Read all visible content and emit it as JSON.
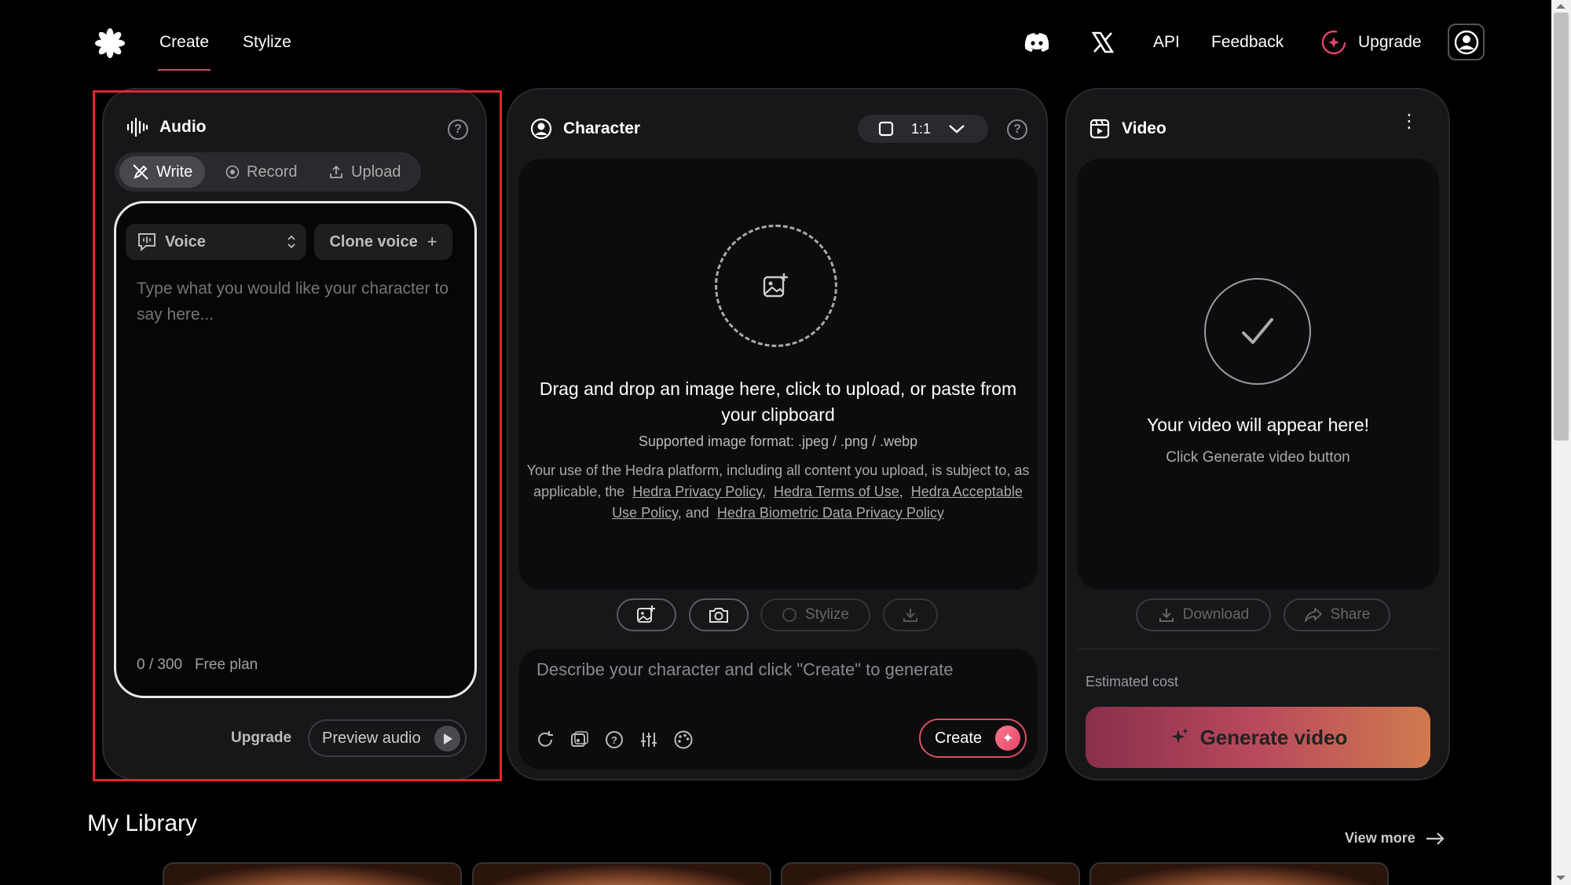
{
  "header": {
    "nav_create": "Create",
    "nav_stylize": "Stylize",
    "api": "API",
    "feedback": "Feedback",
    "upgrade": "Upgrade"
  },
  "audio": {
    "title": "Audio",
    "mode_write": "Write",
    "mode_record": "Record",
    "mode_upload": "Upload",
    "voice_label": "Voice",
    "clone_voice": "Clone voice",
    "placeholder": "Type what you would like your character to say here...",
    "char_count": "0 / 300",
    "plan": "Free plan",
    "upgrade": "Upgrade",
    "preview": "Preview audio"
  },
  "character": {
    "title": "Character",
    "ratio": "1:1",
    "drop_title": "Drag and drop an image here, click to upload, or paste from your clipboard",
    "formats": "Supported image format: .jpeg / .png / .webp",
    "legal_prefix": "Your use of the Hedra platform, including all content you upload, is subject to, as applicable, the",
    "privacy": "Hedra Privacy Policy",
    "terms": "Hedra Terms of Use",
    "aup": "Hedra Acceptable Use Policy",
    "and": ", and",
    "biometric": "Hedra Biometric Data Privacy Policy",
    "stylize": "Stylize",
    "prompt_placeholder": "Describe your character and click \"Create\" to generate",
    "create": "Create"
  },
  "video": {
    "title": "Video",
    "empty_title": "Your video will appear here!",
    "empty_sub": "Click Generate video button",
    "download": "Download",
    "share": "Share",
    "estimated_cost": "Estimated cost",
    "generate": "Generate video"
  },
  "library": {
    "title": "My Library",
    "view_more": "View more"
  },
  "colors": {
    "accent": "#d94f64",
    "highlight_box": "#e0262a"
  }
}
